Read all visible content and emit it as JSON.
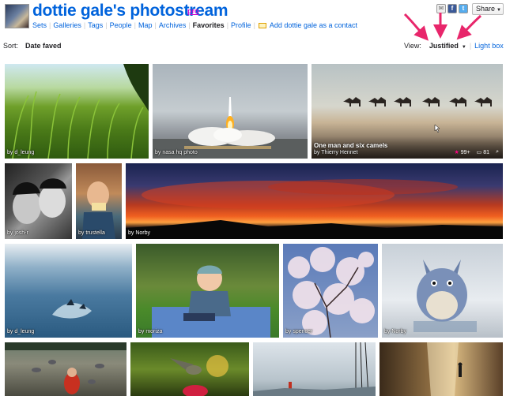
{
  "header": {
    "title": "dottie gale's photostream",
    "pro_badge": "pro",
    "nav": [
      "Sets",
      "Galleries",
      "Tags",
      "People",
      "Map",
      "Archives",
      "Favorites",
      "Profile"
    ],
    "current_nav": "Favorites",
    "contact_link": "Add dottie gale as a contact",
    "share_label": "Share"
  },
  "toolbar": {
    "sort_label": "Sort:",
    "sort_value": "Date faved",
    "view_label": "View:",
    "view_value": "Justified",
    "lightbox_label": "Light box"
  },
  "photos": [
    {
      "by": "by d_leung"
    },
    {
      "by": "by nasa hq photo"
    },
    {
      "title": "One man and six camels",
      "by": "by Thierry Hennet",
      "favs": "99+",
      "comments": "81"
    },
    {
      "by": "by josh-r"
    },
    {
      "by": "by trustella"
    },
    {
      "by": "by Norby"
    },
    {
      "by": "by d_leung"
    },
    {
      "by": "by moriza"
    },
    {
      "by": "by spencer"
    },
    {
      "by": "by Norby"
    }
  ],
  "colors": {
    "link": "#0063dc",
    "pro": "#cc00cc",
    "arrow": "#e8266b"
  }
}
